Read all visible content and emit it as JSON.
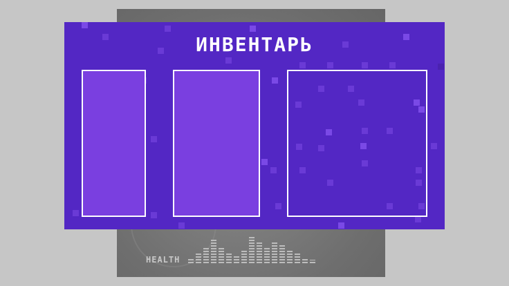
{
  "game": {
    "health_label": "HEALTH",
    "health_meter_levels": [
      0.2,
      0.35,
      0.6,
      0.85,
      0.55,
      0.4,
      0.25,
      0.5,
      0.95,
      0.75,
      0.6,
      0.8,
      0.7,
      0.45,
      0.35,
      0.2,
      0.12
    ]
  },
  "inventory": {
    "title": "ИНВЕНТАРЬ",
    "slots": [
      {
        "name": "slot-1",
        "state": "filled"
      },
      {
        "name": "slot-2",
        "state": "filled"
      },
      {
        "name": "slot-3",
        "state": "empty"
      }
    ]
  },
  "colors": {
    "panel": "#5327c4",
    "slot_fill": "#7a3fe0",
    "slot_border": "#ffffff",
    "backdrop": "#c6c6c6"
  }
}
